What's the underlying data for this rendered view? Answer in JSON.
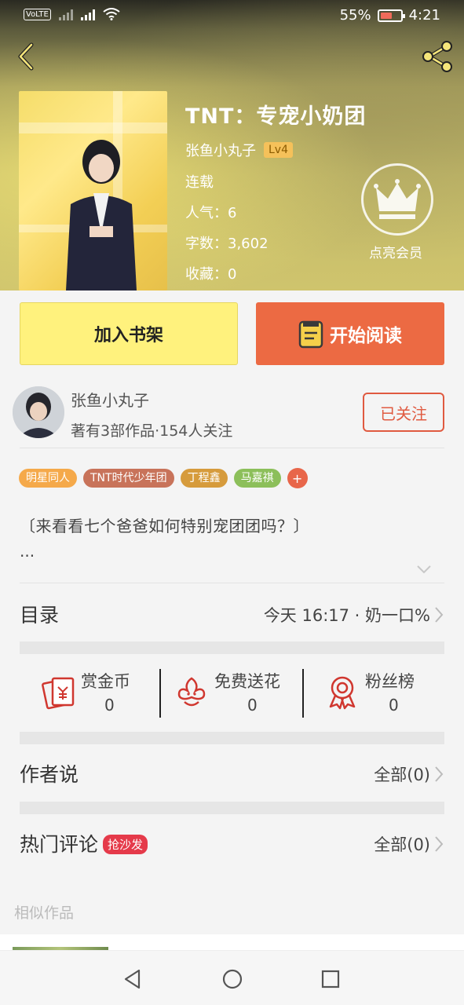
{
  "status_bar": {
    "battery": "55%",
    "time": "4:21",
    "volte": "VoLTE"
  },
  "book": {
    "title": "TNT：专宠小奶团",
    "author": "张鱼小丸子",
    "level": "Lv4",
    "status": "连载",
    "popularity": "人气：6",
    "word_count": "字数：3,602",
    "favorites": "收藏：0"
  },
  "member": {
    "label": "点亮会员"
  },
  "actions": {
    "add_shelf": "加入书架",
    "start_read": "开始阅读"
  },
  "author_row": {
    "name": "张鱼小丸子",
    "stats": "著有3部作品·154人关注",
    "follow": "已关注"
  },
  "tags": [
    {
      "label": "明星同人",
      "color": "#f5a94a"
    },
    {
      "label": "TNT时代少年团",
      "color": "#c8735a"
    },
    {
      "label": "丁程鑫",
      "color": "#d69b3c"
    },
    {
      "label": "马嘉祺",
      "color": "#8cbf5a"
    }
  ],
  "tag_more": "+",
  "description": {
    "text": "〔来看看七个爸爸如何特别宠团团吗？〕",
    "more": "..."
  },
  "catalog": {
    "label": "目录",
    "latest": "今天 16:17 · 奶一口%"
  },
  "rewards": [
    {
      "label": "赏金币",
      "count": "0",
      "icon": "coin-envelope-icon"
    },
    {
      "label": "免费送花",
      "count": "0",
      "icon": "flower-icon"
    },
    {
      "label": "粉丝榜",
      "count": "0",
      "icon": "medal-icon"
    }
  ],
  "author_says": {
    "label": "作者说",
    "right": "全部(0)"
  },
  "comments": {
    "label": "热门评论",
    "badge": "抢沙发",
    "right": "全部(0)"
  },
  "similar": {
    "label": "相似作品"
  },
  "colors": {
    "accent": "#ec6a43",
    "shelf": "#fff27d",
    "follow": "#e05a40",
    "badge": "#e53a4a"
  }
}
